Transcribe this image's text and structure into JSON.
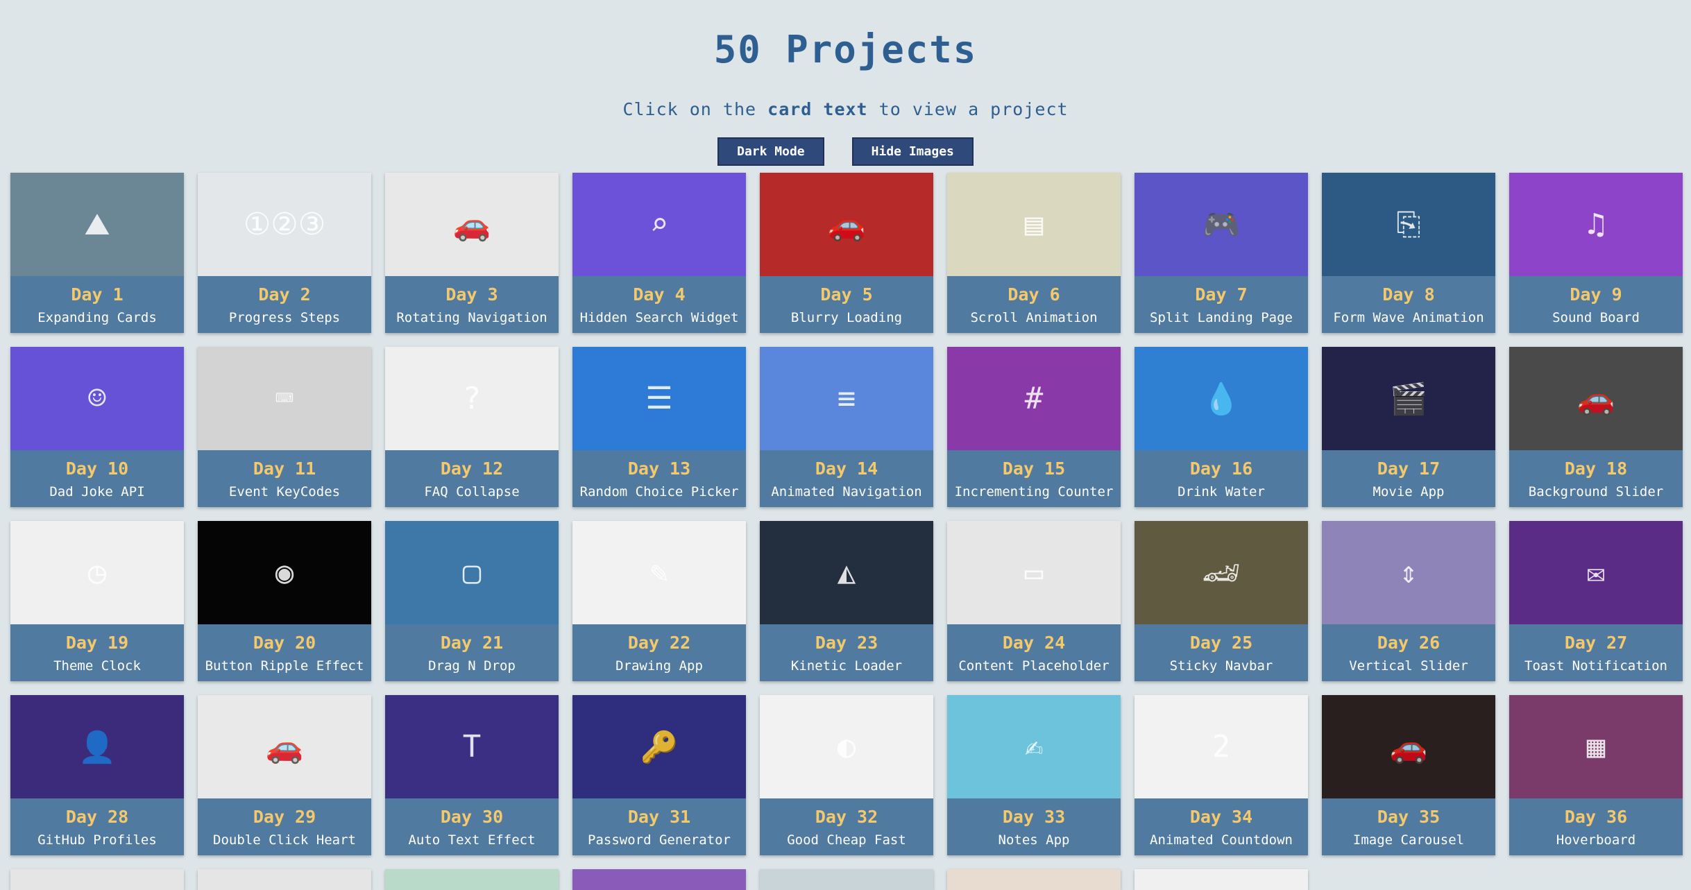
{
  "header": {
    "title": "50 Projects",
    "subtitle_pre": "Click on the",
    "subtitle_bold": "card text",
    "subtitle_post": "to view a project"
  },
  "controls": {
    "dark_mode_label": "Dark Mode",
    "hide_images_label": "Hide Images"
  },
  "colors": {
    "background": "#dde5e9",
    "card": "#517aa0",
    "day_text": "#f4c96b",
    "title": "#2f5f90",
    "button": "#2f4a7a"
  },
  "projects": [
    {
      "day": "Day 1",
      "name": "Expanding Cards",
      "thumb_color": "#6b8796",
      "icon": "landscape-icon"
    },
    {
      "day": "Day 2",
      "name": "Progress Steps",
      "thumb_color": "#e4e7ea",
      "icon": "steps-icon"
    },
    {
      "day": "Day 3",
      "name": "Rotating Navigation",
      "thumb_color": "#e8e8e8",
      "icon": "car-photo-icon"
    },
    {
      "day": "Day 4",
      "name": "Hidden Search Widget",
      "thumb_color": "#6b52d9",
      "icon": "search-icon"
    },
    {
      "day": "Day 5",
      "name": "Blurry Loading",
      "thumb_color": "#b62a2a",
      "icon": "car-photo-icon"
    },
    {
      "day": "Day 6",
      "name": "Scroll Animation",
      "thumb_color": "#dad8be",
      "icon": "content-box-icon"
    },
    {
      "day": "Day 7",
      "name": "Split Landing Page",
      "thumb_color": "#5c55c8",
      "icon": "console-icon"
    },
    {
      "day": "Day 8",
      "name": "Form Wave Animation",
      "thumb_color": "#2d5a85",
      "icon": "login-form-icon"
    },
    {
      "day": "Day 9",
      "name": "Sound Board",
      "thumb_color": "#8e44c9",
      "icon": "sound-buttons-icon"
    },
    {
      "day": "Day 10",
      "name": "Dad Joke API",
      "thumb_color": "#6552d6",
      "icon": "joke-card-icon"
    },
    {
      "day": "Day 11",
      "name": "Event KeyCodes",
      "thumb_color": "#d3d3d3",
      "icon": "keycode-icon"
    },
    {
      "day": "Day 12",
      "name": "FAQ Collapse",
      "thumb_color": "#efefef",
      "icon": "faq-icon"
    },
    {
      "day": "Day 13",
      "name": "Random Choice Picker",
      "thumb_color": "#2d7bd6",
      "icon": "choice-tags-icon"
    },
    {
      "day": "Day 14",
      "name": "Animated Navigation",
      "thumb_color": "#5a86dc",
      "icon": "nav-bar-icon"
    },
    {
      "day": "Day 15",
      "name": "Incrementing Counter",
      "thumb_color": "#8a3aa8",
      "icon": "counter-icon"
    },
    {
      "day": "Day 16",
      "name": "Drink Water",
      "thumb_color": "#2f7fd3",
      "icon": "water-glass-icon"
    },
    {
      "day": "Day 17",
      "name": "Movie App",
      "thumb_color": "#23234a",
      "icon": "movie-posters-icon"
    },
    {
      "day": "Day 18",
      "name": "Background Slider",
      "thumb_color": "#4a4a4a",
      "icon": "car-photo-icon"
    },
    {
      "day": "Day 19",
      "name": "Theme Clock",
      "thumb_color": "#f0f0f0",
      "icon": "clock-icon"
    },
    {
      "day": "Day 20",
      "name": "Button Ripple Effect",
      "thumb_color": "#050505",
      "icon": "ripple-button-icon"
    },
    {
      "day": "Day 21",
      "name": "Drag N Drop",
      "thumb_color": "#3d78a8",
      "icon": "drag-boxes-icon"
    },
    {
      "day": "Day 22",
      "name": "Drawing App",
      "thumb_color": "#f2f2f2",
      "icon": "brush-strokes-icon"
    },
    {
      "day": "Day 23",
      "name": "Kinetic Loader",
      "thumb_color": "#232e3f",
      "icon": "loader-icon"
    },
    {
      "day": "Day 24",
      "name": "Content Placeholder",
      "thumb_color": "#e6e6e6",
      "icon": "placeholder-icon"
    },
    {
      "day": "Day 25",
      "name": "Sticky Navbar",
      "thumb_color": "#5f5a40",
      "icon": "sports-car-icon"
    },
    {
      "day": "Day 26",
      "name": "Vertical Slider",
      "thumb_color": "#8f84b8",
      "icon": "slider-photo-icon"
    },
    {
      "day": "Day 27",
      "name": "Toast Notification",
      "thumb_color": "#5b2c86",
      "icon": "toast-icon"
    },
    {
      "day": "Day 28",
      "name": "GitHub Profiles",
      "thumb_color": "#3c2a7a",
      "icon": "profile-card-icon"
    },
    {
      "day": "Day 29",
      "name": "Double Click Heart",
      "thumb_color": "#e9e9e9",
      "icon": "car-photo-icon"
    },
    {
      "day": "Day 30",
      "name": "Auto Text Effect",
      "thumb_color": "#3b2f84",
      "icon": "text-effect-icon"
    },
    {
      "day": "Day 31",
      "name": "Password Generator",
      "thumb_color": "#2f2d7d",
      "icon": "password-form-icon"
    },
    {
      "day": "Day 32",
      "name": "Good Cheap Fast",
      "thumb_color": "#f2f2f2",
      "icon": "toggles-icon"
    },
    {
      "day": "Day 33",
      "name": "Notes App",
      "thumb_color": "#6cc3db",
      "icon": "notes-icon"
    },
    {
      "day": "Day 34",
      "name": "Animated Countdown",
      "thumb_color": "#f2f2f2",
      "icon": "countdown-icon"
    },
    {
      "day": "Day 35",
      "name": "Image Carousel",
      "thumb_color": "#2a1f1f",
      "icon": "car-photo-icon"
    },
    {
      "day": "Day 36",
      "name": "Hoverboard",
      "thumb_color": "#7a3b6a",
      "icon": "grid-board-icon"
    }
  ],
  "partial_row": [
    {
      "thumb_color": "#e5e5e5"
    },
    {
      "thumb_color": "#e5e5e5"
    },
    {
      "thumb_color": "#b9d9c9"
    },
    {
      "thumb_color": "#8a5bb8"
    },
    {
      "thumb_color": "#c9d4d9"
    },
    {
      "thumb_color": "#e8dcd0"
    },
    {
      "thumb_color": "#f0f0f0"
    },
    {
      "thumb_color": "#dde5e9"
    },
    {
      "thumb_color": "#dde5e9"
    }
  ]
}
